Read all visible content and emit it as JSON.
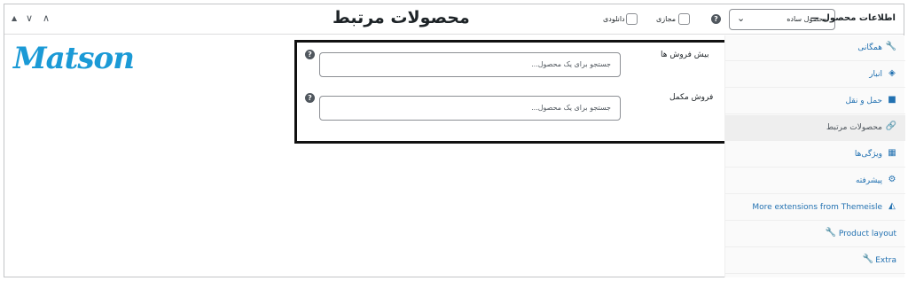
{
  "header": {
    "title": "اطلاعات محصول —",
    "product_type": "محصول ساده",
    "virtual_label": "مجازی",
    "downloadable_label": "دانلودی",
    "big_title": "محصولات مرتبط",
    "help_glyph": "?",
    "controls": {
      "up": "∧",
      "down": "∨",
      "up_small": "▲"
    }
  },
  "logo": {
    "text": "Matson",
    "color": "#1b9ad6"
  },
  "tabs": [
    {
      "label": "همگانی",
      "icon": "wrench-icon",
      "glyph": "🔧"
    },
    {
      "label": "انبار",
      "icon": "tag-icon",
      "glyph": "◈"
    },
    {
      "label": "حمل و نقل",
      "icon": "truck-icon",
      "glyph": "■"
    },
    {
      "label": "محصولات مرتبط",
      "icon": "link-icon",
      "glyph": "🔗",
      "active": true
    },
    {
      "label": "ویژگی‌ها",
      "icon": "table-icon",
      "glyph": "▦"
    },
    {
      "label": "پیشرفته",
      "icon": "gear-icon",
      "glyph": "⚙"
    },
    {
      "label": "More extensions from Themeisle",
      "icon": "puzzle-icon",
      "glyph": "◭"
    },
    {
      "label": "Product layout",
      "icon": "wrench-icon",
      "glyph": "🔧"
    },
    {
      "label": "Extra",
      "icon": "wrench-icon",
      "glyph": "🔧"
    }
  ],
  "fields": {
    "upsells": {
      "label": "بیش فروش ها",
      "placeholder": "جستجو برای یک محصول..."
    },
    "crosssells": {
      "label": "فروش مکمل",
      "placeholder": "جستجو برای یک محصول..."
    }
  },
  "colors": {
    "accent": "#2271b1",
    "logo": "#1b9ad6",
    "highlight_border": "#111111"
  }
}
